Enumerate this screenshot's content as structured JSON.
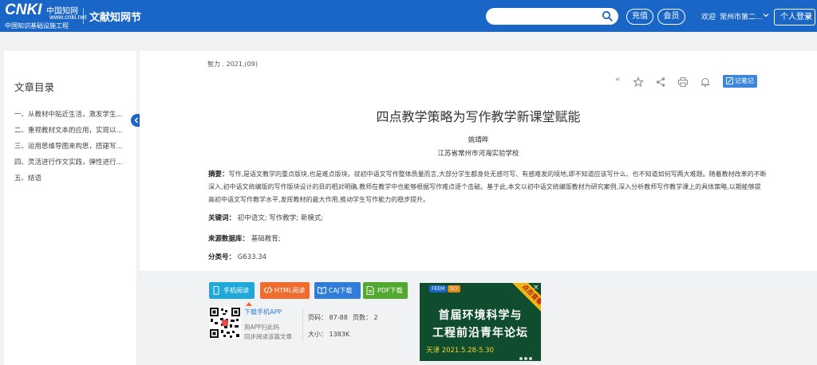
{
  "header": {
    "logo_text": "CNKI",
    "logo_cn": "中国知网",
    "logo_url": "www.cnki.net",
    "logo_slogan": "中国知识基础设施工程",
    "site_name": "文献知网节",
    "search_placeholder": "",
    "recharge_label": "充值",
    "member_label": "会员",
    "welcome_label": "欢迎",
    "user_name": "常州市第二...",
    "login_label": "个人登录"
  },
  "sidebar": {
    "title": "文章目录",
    "items": [
      "一、从教材中贴近生活，激发学生...",
      "二、重视教材文本的应用，实现以...",
      "三、运用思维导图来构思，搭建写...",
      "四、灵活进行作文实践，弹性进行...",
      "五、结语"
    ]
  },
  "article": {
    "journal": "智力 . 2021,(09)",
    "note_label": "记笔记",
    "title": "四点教学策略为写作教学新课堂赋能",
    "author": "姚靖晔",
    "affiliation": "江苏省常州市河海实验学校",
    "abstract_label": "摘要：",
    "abstract_text": "写作,是语文教学的重点版块,也是难点版块。就初中语文写作整体质量而言,大部分学生都身处无感可写、有感难发的境地,即不知道应该写什么、也不知道如何写两大难题。随着教材改革的不断深入,初中语文统编版的写作版块设计的目的相对明确,教师在教学中也能够根据写作难点逐个击破。基于此,本文以初中语文统编版教材为研究案例,深入分析教师写作教学课上的具体策略,以期能够提高初中语文写作教学水平,发挥教材的最大作用,推动学生写作能力的稳步提升。",
    "keywords_label": "关键词：",
    "keywords": "初中语文;  写作教学;  新模式;",
    "source_label": "来源数据库：",
    "source": "基础教育;",
    "class_label": "分类号：",
    "class_code": "G633.34"
  },
  "download": {
    "mobile_label": "手机阅读",
    "html_label": "HTML阅读",
    "caj_label": "CAJ下载",
    "pdf_label": "PDF下载",
    "app_link": "下载手机APP",
    "app_desc1": "用APP扫此码",
    "app_desc2": "同步阅读该篇文章",
    "pages": "页码：  87-88",
    "page_count": "页数：  2",
    "size": "大小：  1383K"
  },
  "ad": {
    "badge": "点击查看",
    "close": "×",
    "logo1": "FEEM",
    "logo2": "SCI",
    "line1": "首届环境科学与",
    "line2": "工程前沿青年论坛",
    "date": "天津  2021.5.28-5.30"
  },
  "colors": {
    "header_bg": "#1a66c7",
    "accent": "#2f7dd8"
  }
}
